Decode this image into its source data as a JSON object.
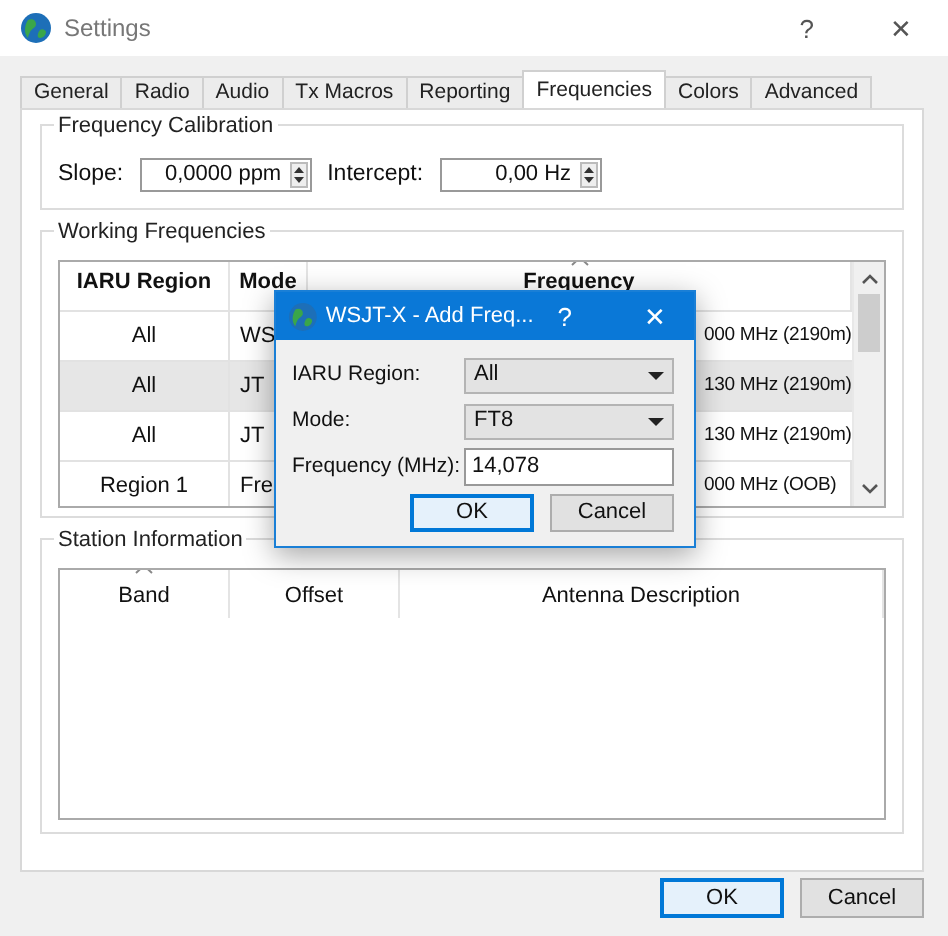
{
  "window": {
    "title": "Settings",
    "help": "?",
    "close": "✕"
  },
  "tabs": [
    {
      "label": "General",
      "selected": false
    },
    {
      "label": "Radio",
      "selected": false
    },
    {
      "label": "Audio",
      "selected": false
    },
    {
      "label": "Tx Macros",
      "selected": false
    },
    {
      "label": "Reporting",
      "selected": false
    },
    {
      "label": "Frequencies",
      "selected": true
    },
    {
      "label": "Colors",
      "selected": false
    },
    {
      "label": "Advanced",
      "selected": false
    }
  ],
  "frequency_calibration": {
    "title": "Frequency Calibration",
    "slope": {
      "label": "Slope:",
      "value": "0,0000 ppm"
    },
    "intercept": {
      "label": "Intercept:",
      "value": "0,00 Hz"
    }
  },
  "working_frequencies": {
    "title": "Working Frequencies",
    "columns": [
      {
        "label": "IARU Region",
        "sorted": false
      },
      {
        "label": "Mode",
        "sorted": false
      },
      {
        "label": "Frequency",
        "sorted": true
      }
    ],
    "rows": [
      {
        "cells": [
          "All",
          "WS",
          "000 MHz (2190m)"
        ],
        "selected": false
      },
      {
        "cells": [
          "All",
          "JT",
          "130 MHz (2190m)"
        ],
        "selected": true
      },
      {
        "cells": [
          "All",
          "JT",
          "130 MHz (2190m)"
        ],
        "selected": false
      },
      {
        "cells": [
          "Region 1",
          "Fre",
          "000 MHz (OOB)"
        ],
        "selected": false
      }
    ]
  },
  "station_information": {
    "title": "Station Information",
    "columns": [
      {
        "label": "Band",
        "sorted": true
      },
      {
        "label": "Offset",
        "sorted": false
      },
      {
        "label": "Antenna Description",
        "sorted": false
      }
    ]
  },
  "buttons": [
    {
      "label": "OK",
      "default": true
    },
    {
      "label": "Cancel",
      "default": false
    }
  ],
  "dialog": {
    "title": "WSJT-X - Add Freq...",
    "help": "?",
    "close": "✕",
    "fields": [
      {
        "label": "IARU Region:",
        "kind": "combo",
        "value": "All"
      },
      {
        "label": "Mode:",
        "kind": "combo",
        "value": "FT8"
      },
      {
        "label": "Frequency (MHz):",
        "kind": "text",
        "value": "14,078"
      }
    ],
    "buttons": [
      {
        "label": "OK",
        "default": true
      },
      {
        "label": "Cancel",
        "default": false
      }
    ]
  }
}
